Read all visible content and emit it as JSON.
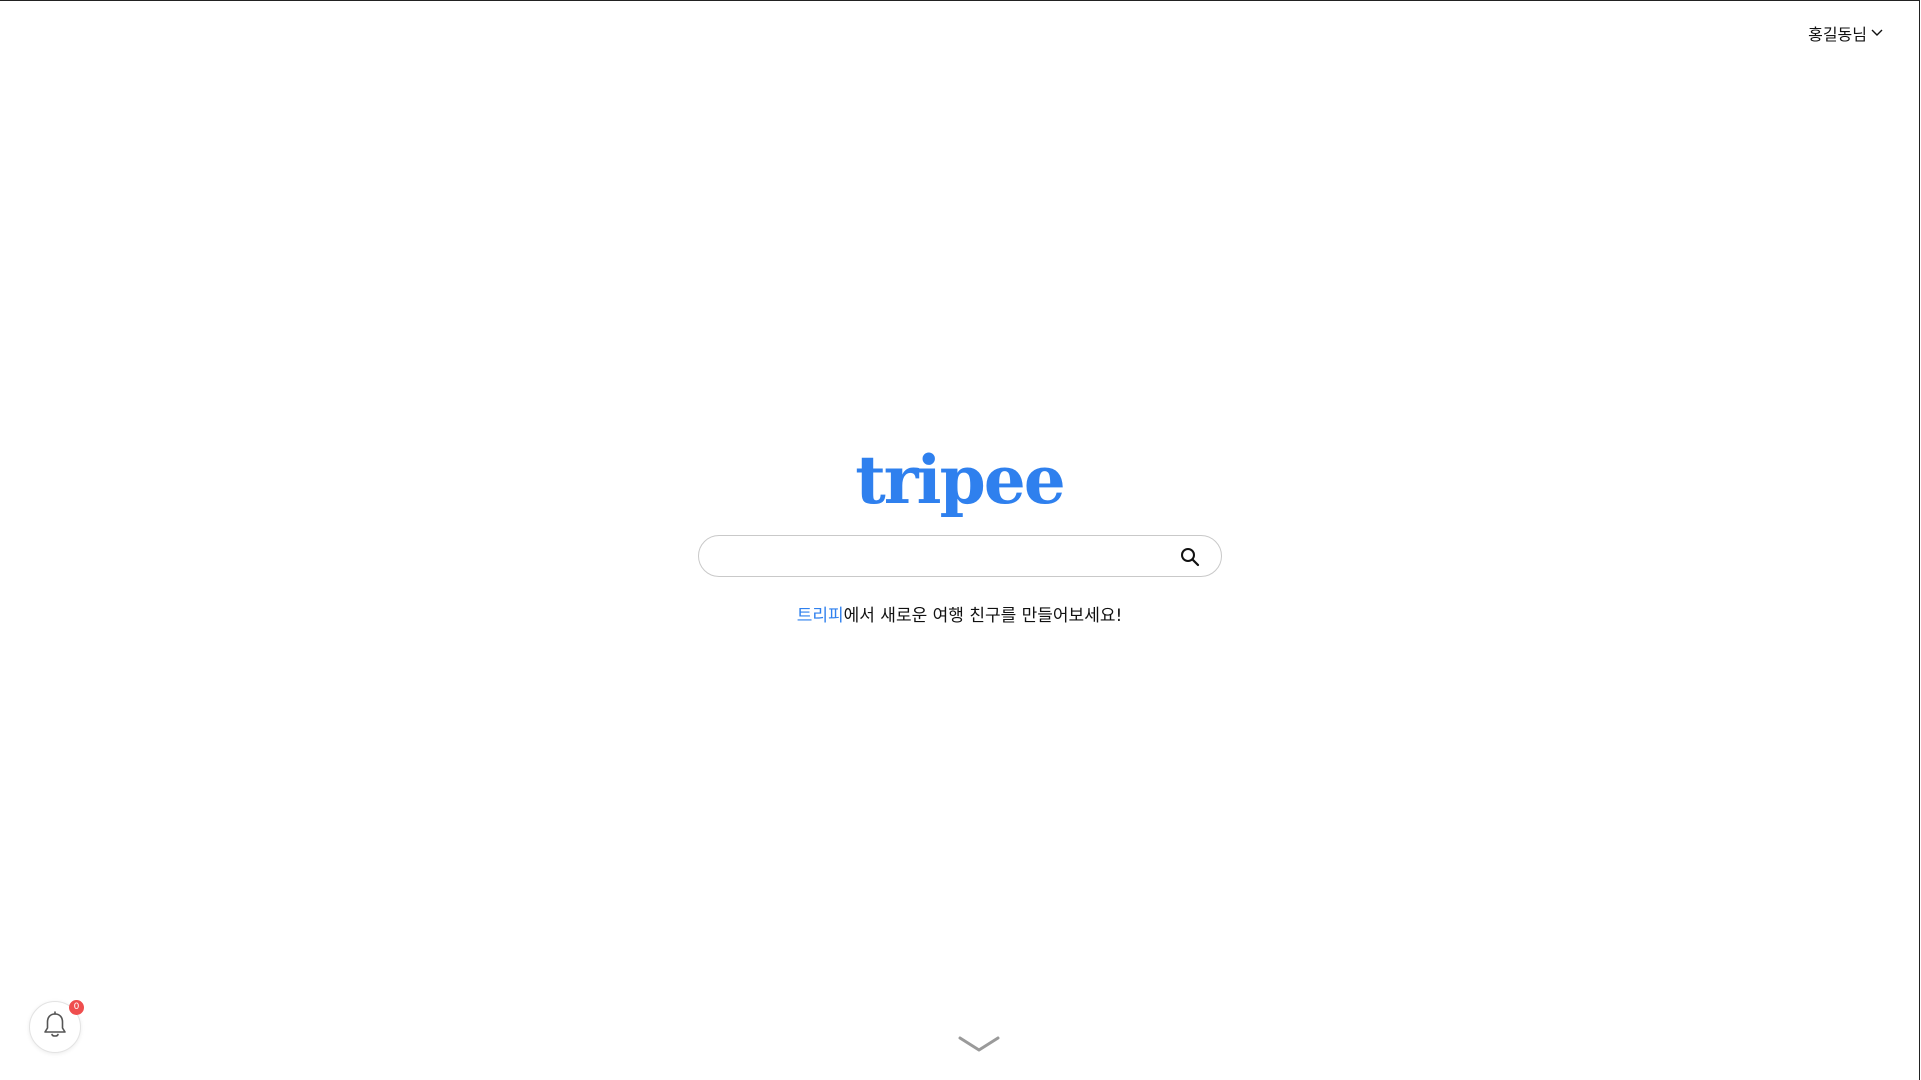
{
  "header": {
    "user_name": "홍길동님",
    "user_menu_icon": "chevron-down-icon"
  },
  "brand": {
    "logo_text": "tripee",
    "accent_color": "#2f80ee"
  },
  "search": {
    "value": "",
    "placeholder": "",
    "icon": "search-icon"
  },
  "tagline": {
    "brand_part": "트리피",
    "rest": "에서 새로운 여행 친구를 만들어보세요!"
  },
  "notifications": {
    "icon": "bell-icon",
    "count": "0",
    "badge_color": "#ef4e4e"
  },
  "scroll_hint": {
    "icon": "chevron-down-icon"
  }
}
